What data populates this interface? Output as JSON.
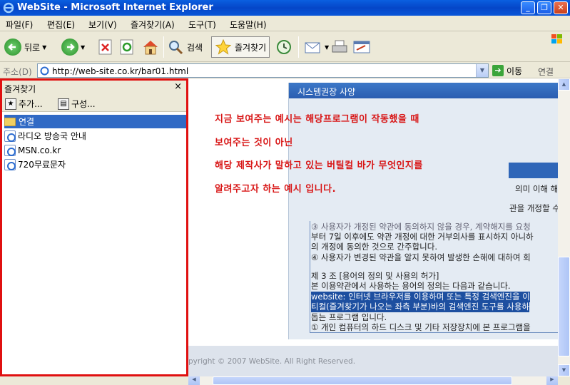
{
  "window": {
    "title": "WebSite - Microsoft Internet Explorer"
  },
  "menu": [
    "파일(F)",
    "편집(E)",
    "보기(V)",
    "즐겨찾기(A)",
    "도구(T)",
    "도움말(H)"
  ],
  "toolbar": {
    "back": "뒤로",
    "search": "검색",
    "favorites": "즐겨찾기"
  },
  "address": {
    "label": "주소(D)",
    "url": "http://web-site.co.kr/bar01.html",
    "go": "이동",
    "links": "연결"
  },
  "favorites": {
    "title": "즐겨찾기",
    "close": "×",
    "add": "추가...",
    "organize": "구성...",
    "items": [
      {
        "label": "연결",
        "kind": "folder"
      },
      {
        "label": "라디오 방송국 안내",
        "kind": "page"
      },
      {
        "label": "MSN.co.kr",
        "kind": "page"
      },
      {
        "label": "720무료문자",
        "kind": "page"
      }
    ]
  },
  "content": {
    "dialog_title": "시스템권장 사양",
    "notice_lines": [
      "지금 보여주는 예시는 해당프로그램이 작동했을 때",
      "보여주는 것이 아닌",
      "해당 제작사가 말하고 있는 버틸컬 바가 무엇인지를",
      "알려주고자 하는 예시 입니다."
    ],
    "text_lines": [
      "의미 이해 해",
      "관을 개정할 수",
      "③ 사용자가 개정된 약관에 동의하지 않을 경우, 계약해지를 요청",
      "부터 7일 이후에도 약관 개정에 대한 거부의사를 표시하지 아니하",
      "의 개정에 동의한 것으로 간주합니다.",
      "④ 사용자가 변경된 약관을 알지 못하여 발생한 손해에 대하여 회",
      "",
      "제 3 조 [용어의 정의 및 사용의 허가]",
      "본 이용약관에서 사용하는 용어의 정의는 다음과 같습니다.",
      "website: 인터넷 브라우저를 이용하며 또는 특정 검색엔진을 이",
      "티컬(즐겨찾기가 나오는 좌측 부분)바의 검색엔진 도구를 사용하",
      "돕는 프로그램 입니다.",
      "① 개인 컴퓨터의 하드 디스크 및 기타 저장장치에 본 프로그램을"
    ],
    "footer": "pyright © 2007 WebSite. All Right Reserved."
  }
}
